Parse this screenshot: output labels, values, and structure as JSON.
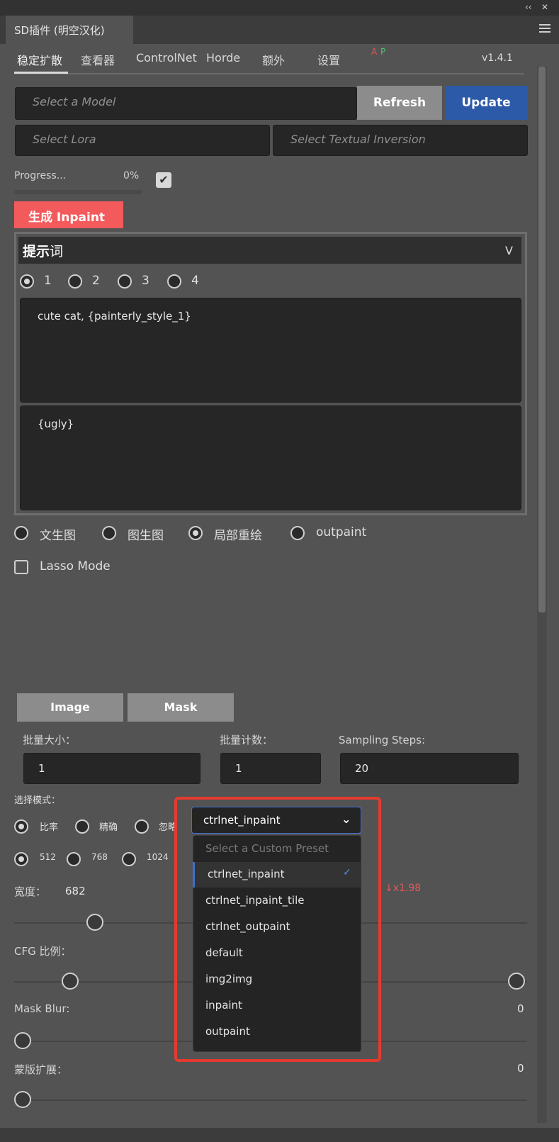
{
  "window": {
    "collapse_label": "‹‹",
    "close_label": "✕",
    "panel_title": "SD插件 (明空汉化)"
  },
  "tabs": [
    {
      "label": "稳定扩散"
    },
    {
      "label": "查看器"
    },
    {
      "label": "ControlNet"
    },
    {
      "label": "Horde"
    },
    {
      "label": "额外"
    },
    {
      "label": "设置"
    }
  ],
  "indicators": {
    "a": "A",
    "p": "P"
  },
  "version": "v1.4.1",
  "model": {
    "model_placeholder": "Select a Model",
    "refresh_label": "Refresh",
    "update_label": "Update",
    "lora_placeholder": "Select Lora",
    "textual_inversion_placeholder": "Select Textual Inversion"
  },
  "progress": {
    "label": "Progress...",
    "value": "0%",
    "fraction": 0,
    "checked_mark": "✔"
  },
  "generate_label": "生成 Inpaint",
  "prompt": {
    "title_bold": "提示",
    "title_rest": "词",
    "chevron": "V",
    "slots": [
      "1",
      "2",
      "3",
      "4"
    ],
    "selected_slot": "1",
    "positive": "cute cat, {painterly_style_1}",
    "negative": "{ugly}"
  },
  "modes": [
    {
      "label": "文生图"
    },
    {
      "label": "图生图"
    },
    {
      "label": "局部重绘"
    },
    {
      "label": "outpaint"
    }
  ],
  "selected_mode": "局部重绘",
  "lasso_label": "Lasso Mode",
  "image_buttons": {
    "image_label": "Image",
    "mask_label": "Mask"
  },
  "batch": {
    "size_label": "批量大小：",
    "size_value": "1",
    "count_label": "批量计数：",
    "count_value": "1",
    "steps_label": "Sampling Steps:",
    "steps_value": "20"
  },
  "select_mode": {
    "label": "选择模式：",
    "options": [
      {
        "label": "比率"
      },
      {
        "label": "精确"
      },
      {
        "label": "忽略"
      }
    ],
    "selected": "比率"
  },
  "resolution": {
    "options": [
      {
        "label": "512"
      },
      {
        "label": "768"
      },
      {
        "label": "1024"
      }
    ],
    "selected": "512"
  },
  "width": {
    "label": "宽度：",
    "value": "682",
    "ratio": "↓x1.98"
  },
  "cfg": {
    "label": "CFG 比例："
  },
  "mask_blur": {
    "label": "Mask Blur:",
    "value": "0"
  },
  "mask_expand": {
    "label": "蒙版扩展：",
    "value": "0"
  },
  "preset": {
    "selected": "ctrlnet_inpaint",
    "placeholder": "Select a Custom Preset",
    "check_mark": "✓",
    "options": [
      "ctrlnet_inpaint",
      "ctrlnet_inpaint_tile",
      "ctrlnet_outpaint",
      "default",
      "img2img",
      "inpaint",
      "outpaint"
    ]
  },
  "colors": {
    "accent_blue": "#2d5aa8",
    "generate_red": "#f35a5c",
    "highlight_red": "#e53a2f",
    "panel_bg": "#535353"
  }
}
